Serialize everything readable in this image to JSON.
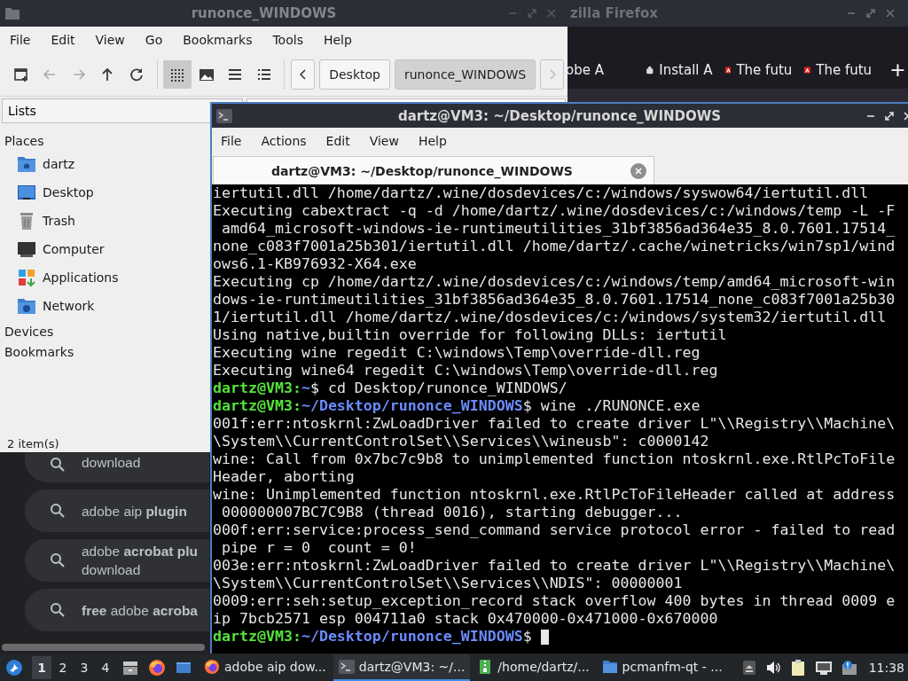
{
  "firefox": {
    "title": "zilla Firefox",
    "tabs": [
      {
        "label": "obe A",
        "kind": "plain"
      },
      {
        "label": "Install A",
        "kind": "addon"
      },
      {
        "label": "The futu",
        "kind": "adobe"
      },
      {
        "label": "The futu",
        "kind": "adobe"
      }
    ],
    "new_tab": "+",
    "suggestions": [
      {
        "lines": [
          "download"
        ]
      },
      {
        "lines": [
          "adobe aip **plugin**"
        ]
      },
      {
        "lines": [
          "adobe **acrobat plu**",
          "download"
        ]
      },
      {
        "lines": [
          "**free** adobe **acroba**"
        ]
      }
    ]
  },
  "file_manager": {
    "title": "runonce_WINDOWS",
    "menu": [
      "File",
      "Edit",
      "View",
      "Go",
      "Bookmarks",
      "Tools",
      "Help"
    ],
    "nav_buttons": [
      {
        "kind": "new-window",
        "disabled": false
      },
      {
        "kind": "back",
        "disabled": true
      },
      {
        "kind": "forward",
        "disabled": true
      },
      {
        "kind": "up",
        "disabled": false
      },
      {
        "kind": "reload",
        "disabled": false
      }
    ],
    "view_buttons": [
      {
        "kind": "icons",
        "selected": true
      },
      {
        "kind": "thumbnails",
        "selected": false
      },
      {
        "kind": "compact",
        "selected": false
      },
      {
        "kind": "details",
        "selected": false
      }
    ],
    "path": [
      {
        "label": "Desktop",
        "selected": false
      },
      {
        "label": "runonce_WINDOWS",
        "selected": true
      }
    ],
    "side_pane": {
      "mode": "Lists",
      "places_heading": "Places",
      "places": [
        {
          "label": "dartz",
          "kind": "home"
        },
        {
          "label": "Desktop",
          "kind": "desktop"
        },
        {
          "label": "Trash",
          "kind": "trash"
        },
        {
          "label": "Computer",
          "kind": "computer"
        },
        {
          "label": "Applications",
          "kind": "applications"
        },
        {
          "label": "Network",
          "kind": "network"
        }
      ],
      "sections": [
        "Devices",
        "Bookmarks"
      ]
    },
    "status": "2 item(s)"
  },
  "terminal": {
    "title": "dartz@VM3: ~/Desktop/runonce_WINDOWS",
    "menu": [
      "File",
      "Actions",
      "Edit",
      "View",
      "Help"
    ],
    "tab": "dartz@VM3: ~/Desktop/runonce_WINDOWS",
    "lines": [
      {
        "kind": "output",
        "text": "iertutil.dll /home/dartz/.wine/dosdevices/c:/windows/syswow64/iertutil.dll"
      },
      {
        "kind": "output",
        "text": "Executing cabextract -q -d /home/dartz/.wine/dosdevices/c:/windows/temp -L -F"
      },
      {
        "kind": "output",
        "text": " amd64_microsoft-windows-ie-runtimeutilities_31bf3856ad364e35_8.0.7601.17514_"
      },
      {
        "kind": "output",
        "text": "none_c083f7001a25b301/iertutil.dll /home/dartz/.cache/winetricks/win7sp1/wind"
      },
      {
        "kind": "output",
        "text": "ows6.1-KB976932-X64.exe"
      },
      {
        "kind": "output",
        "text": "Executing cp /home/dartz/.wine/dosdevices/c:/windows/temp/amd64_microsoft-win"
      },
      {
        "kind": "output",
        "text": "dows-ie-runtimeutilities_31bf3856ad364e35_8.0.7601.17514_none_c083f7001a25b30"
      },
      {
        "kind": "output",
        "text": "1/iertutil.dll /home/dartz/.wine/dosdevices/c:/windows/system32/iertutil.dll"
      },
      {
        "kind": "output",
        "text": "Using native,builtin override for following DLLs: iertutil"
      },
      {
        "kind": "output",
        "text": "Executing wine regedit C:\\windows\\Temp\\override-dll.reg"
      },
      {
        "kind": "output",
        "text": "Executing wine64 regedit C:\\windows\\Temp\\override-dll.reg"
      },
      {
        "kind": "prompt",
        "user_host": "dartz@VM3:",
        "path": "~",
        "command": "$ cd Desktop/runonce_WINDOWS/",
        "cursor": false
      },
      {
        "kind": "prompt",
        "user_host": "dartz@VM3:",
        "path": "~/Desktop/runonce_WINDOWS",
        "command": "$ wine ./RUNONCE.exe",
        "cursor": false
      },
      {
        "kind": "output",
        "text": "001f:err:ntoskrnl:ZwLoadDriver failed to create driver L\"\\\\Registry\\\\Machine\\"
      },
      {
        "kind": "output",
        "text": "\\System\\\\CurrentControlSet\\\\Services\\\\wineusb\": c0000142"
      },
      {
        "kind": "output",
        "text": "wine: Call from 0x7bc7c9b8 to unimplemented function ntoskrnl.exe.RtlPcToFile"
      },
      {
        "kind": "output",
        "text": "Header, aborting"
      },
      {
        "kind": "output",
        "text": "wine: Unimplemented function ntoskrnl.exe.RtlPcToFileHeader called at address"
      },
      {
        "kind": "output",
        "text": " 000000007BC7C9B8 (thread 0016), starting debugger..."
      },
      {
        "kind": "output",
        "text": "000f:err:service:process_send_command service protocol error - failed to read"
      },
      {
        "kind": "output",
        "text": " pipe r = 0  count = 0!"
      },
      {
        "kind": "output",
        "text": "003e:err:ntoskrnl:ZwLoadDriver failed to create driver L\"\\\\Registry\\\\Machine\\"
      },
      {
        "kind": "output",
        "text": "\\System\\\\CurrentControlSet\\\\Services\\\\NDIS\": 00000001"
      },
      {
        "kind": "output",
        "text": "0009:err:seh:setup_exception_record stack overflow 400 bytes in thread 0009 e"
      },
      {
        "kind": "output",
        "text": "ip 7bcb2571 esp 004711a0 stack 0x470000-0x471000-0x670000"
      },
      {
        "kind": "prompt",
        "user_host": "dartz@VM3:",
        "path": "~/Desktop/runonce_WINDOWS",
        "command": "$ ",
        "cursor": true
      }
    ]
  },
  "taskbar": {
    "workspaces": [
      {
        "label": "1",
        "selected": true
      },
      {
        "label": "2",
        "selected": false
      },
      {
        "label": "3",
        "selected": false
      },
      {
        "label": "4",
        "selected": false
      }
    ],
    "launchers": [
      {
        "kind": "files"
      },
      {
        "kind": "firefox"
      },
      {
        "kind": "desktop"
      }
    ],
    "tasks": [
      {
        "label": "adobe aip dow...",
        "kind": "firefox",
        "selected": false
      },
      {
        "label": "dartz@VM3: ~/...",
        "kind": "terminal",
        "selected": true
      },
      {
        "label": "/home/dartz/...",
        "kind": "archive",
        "selected": false
      },
      {
        "label": "pcmanfm-qt - ...",
        "kind": "folder",
        "selected": false
      }
    ],
    "tray": [
      {
        "kind": "arrow"
      },
      {
        "kind": "volume"
      },
      {
        "kind": "clipboard"
      },
      {
        "kind": "network"
      },
      {
        "kind": "info"
      }
    ],
    "clock": "11:38"
  }
}
